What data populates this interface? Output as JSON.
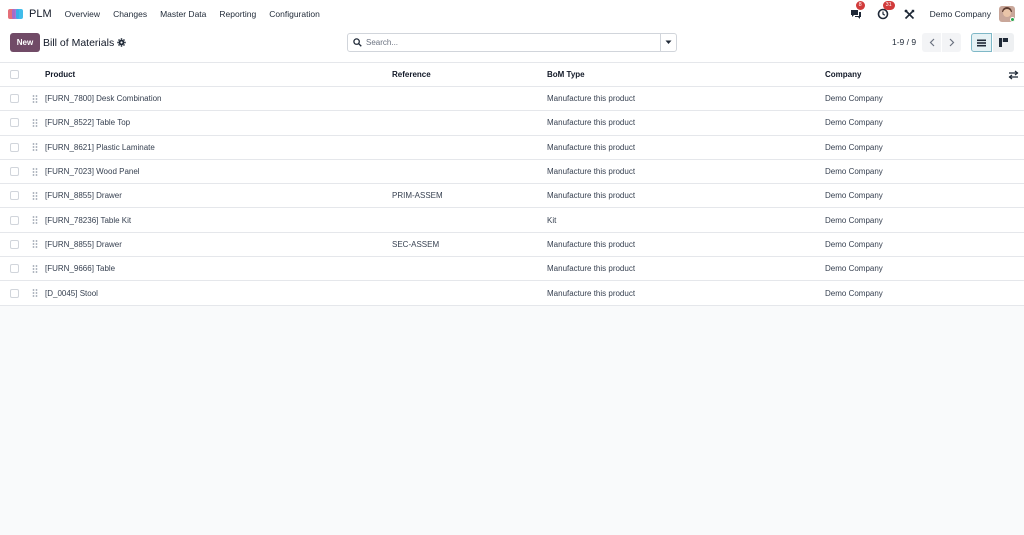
{
  "app": {
    "name": "PLM",
    "menu": [
      "Overview",
      "Changes",
      "Master Data",
      "Reporting",
      "Configuration"
    ]
  },
  "systray": {
    "messages_badge": "8",
    "activities_badge": "31",
    "company": "Demo Company"
  },
  "control": {
    "new_label": "New",
    "title": "Bill of Materials",
    "search_placeholder": "Search...",
    "pager": "1-9 / 9"
  },
  "table": {
    "columns": [
      "Product",
      "Reference",
      "BoM Type",
      "Company"
    ],
    "rows": [
      {
        "product": "[FURN_7800] Desk Combination",
        "reference": "",
        "type": "Manufacture this product",
        "company": "Demo Company"
      },
      {
        "product": "[FURN_8522] Table Top",
        "reference": "",
        "type": "Manufacture this product",
        "company": "Demo Company"
      },
      {
        "product": "[FURN_8621] Plastic Laminate",
        "reference": "",
        "type": "Manufacture this product",
        "company": "Demo Company"
      },
      {
        "product": "[FURN_7023] Wood Panel",
        "reference": "",
        "type": "Manufacture this product",
        "company": "Demo Company"
      },
      {
        "product": "[FURN_8855] Drawer",
        "reference": "PRIM-ASSEM",
        "type": "Manufacture this product",
        "company": "Demo Company"
      },
      {
        "product": "[FURN_78236] Table Kit",
        "reference": "",
        "type": "Kit",
        "company": "Demo Company"
      },
      {
        "product": "[FURN_8855] Drawer",
        "reference": "SEC-ASSEM",
        "type": "Manufacture this product",
        "company": "Demo Company"
      },
      {
        "product": "[FURN_9666] Table",
        "reference": "",
        "type": "Manufacture this product",
        "company": "Demo Company"
      },
      {
        "product": "[D_0045] Stool",
        "reference": "",
        "type": "Manufacture this product",
        "company": "Demo Company"
      }
    ]
  },
  "colors": {
    "brand": "#714b67",
    "badge": "#d13b3b",
    "active_view": "#e6f2f5"
  },
  "icons": [
    "app-logo-icon",
    "chat-icon",
    "activity-clock-icon",
    "tools-icon",
    "gear-icon",
    "search-icon",
    "caret-down-icon",
    "chevron-left-icon",
    "chevron-right-icon",
    "list-view-icon",
    "kanban-view-icon",
    "drag-handle-icon",
    "optional-columns-icon"
  ]
}
